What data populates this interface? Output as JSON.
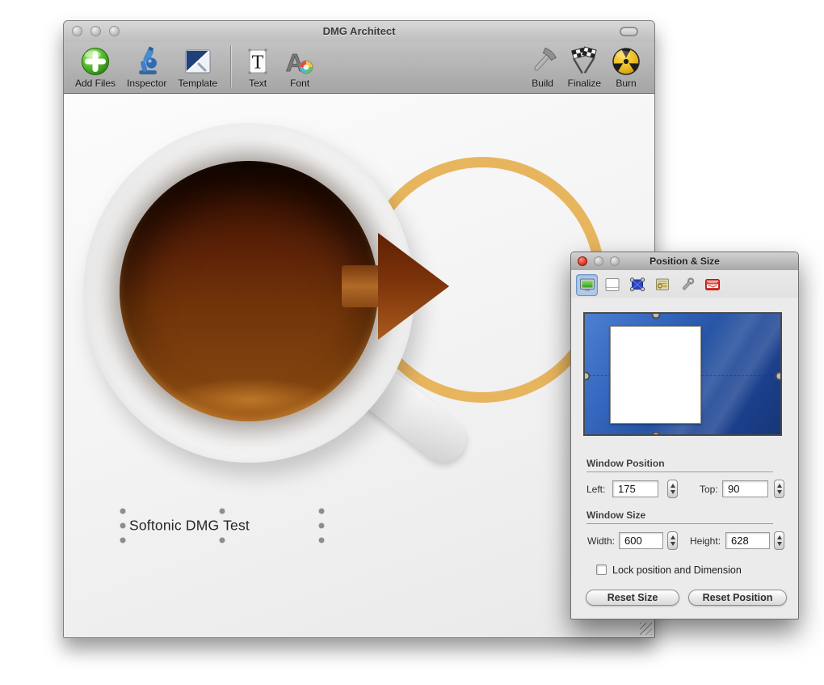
{
  "window": {
    "title": "DMG Architect",
    "toolbar": {
      "left": [
        {
          "label": "Add Files",
          "icon": "add-files-icon"
        },
        {
          "label": "Inspector",
          "icon": "inspector-icon"
        },
        {
          "label": "Template",
          "icon": "template-icon"
        }
      ],
      "middle": [
        {
          "label": "Text",
          "icon": "text-icon",
          "glyph": "T"
        },
        {
          "label": "Font",
          "icon": "font-icon",
          "glyph": "A"
        }
      ],
      "right": [
        {
          "label": "Build",
          "icon": "build-icon"
        },
        {
          "label": "Finalize",
          "icon": "finalize-icon"
        },
        {
          "label": "Burn",
          "icon": "burn-icon"
        }
      ]
    },
    "canvas": {
      "volume_label": "Softonic DMG Test"
    }
  },
  "panel": {
    "title": "Position & Size",
    "tabs": [
      {
        "name": "position-size",
        "icon": "display-icon",
        "selected": true
      },
      {
        "name": "window",
        "icon": "window-icon",
        "selected": false
      },
      {
        "name": "selection",
        "icon": "selection-handles-icon",
        "selected": false
      },
      {
        "name": "license",
        "icon": "certificate-key-icon",
        "selected": false
      },
      {
        "name": "tools",
        "icon": "wrench-icon",
        "selected": false
      },
      {
        "name": "badge",
        "icon": "name-badge-icon",
        "selected": false
      }
    ],
    "position": {
      "heading": "Window Position",
      "left_label": "Left:",
      "left_value": "175",
      "top_label": "Top:",
      "top_value": "90"
    },
    "size": {
      "heading": "Window Size",
      "width_label": "Width:",
      "width_value": "600",
      "height_label": "Height:",
      "height_value": "628"
    },
    "lock_checkbox": {
      "label": "Lock position and Dimension",
      "checked": false
    },
    "buttons": {
      "reset_size": "Reset Size",
      "reset_position": "Reset Position"
    }
  },
  "colors": {
    "stain_ring": "#e7b156",
    "coffee_dark": "#2e0c02",
    "coffee_light": "#8a4b12",
    "arrow_dark": "#5e2104",
    "arrow_light": "#a85a1d",
    "preview_blue": "#2a55a8",
    "tab_selected": "#aecaec"
  }
}
